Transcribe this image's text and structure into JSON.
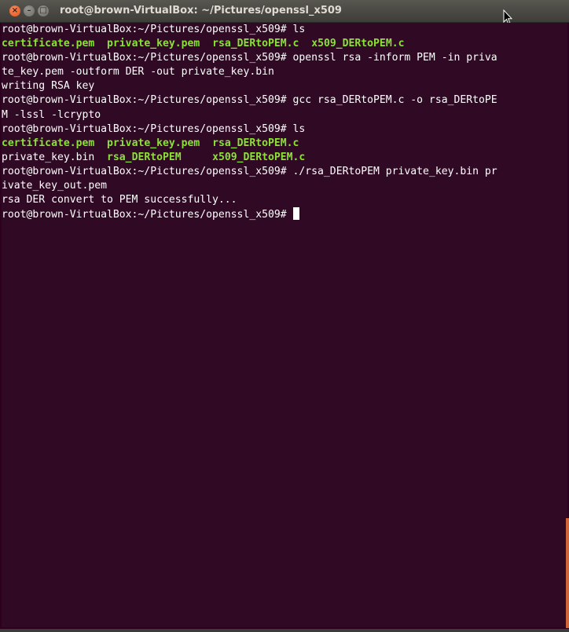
{
  "window": {
    "title": "root@brown-VirtualBox: ~/Pictures/openssl_x509",
    "close_glyph": "×",
    "minimize_glyph": "–",
    "maximize_glyph": "□"
  },
  "terminal": {
    "lines": [
      "root@brown-VirtualBox:~/Pictures/openssl_x509# ls",
      [
        "certificate.pem",
        "  ",
        "private_key.pem",
        "  ",
        "rsa_DERtoPEM.c",
        "  ",
        "x509_DERtoPEM.c"
      ],
      "root@brown-VirtualBox:~/Pictures/openssl_x509# openssl rsa -inform PEM -in priva",
      "te_key.pem -outform DER -out private_key.bin",
      "writing RSA key",
      "root@brown-VirtualBox:~/Pictures/openssl_x509# gcc rsa_DERtoPEM.c -o rsa_DERtoPE",
      "M -lssl -lcrypto",
      "root@brown-VirtualBox:~/Pictures/openssl_x509# ls",
      [
        "certificate.pem",
        "  ",
        "private_key.pem",
        "  ",
        "rsa_DERtoPEM.c"
      ],
      [
        "private_key.bin",
        "  ",
        "rsa_DERtoPEM",
        "     ",
        "x509_DERtoPEM.c"
      ],
      "root@brown-VirtualBox:~/Pictures/openssl_x509# ./rsa_DERtoPEM private_key.bin pr",
      "ivate_key_out.pem",
      "rsa DER convert to PEM successfully...",
      "root@brown-VirtualBox:~/Pictures/openssl_x509# "
    ]
  },
  "colors": {
    "background": "#300a24",
    "text": "#ffffff",
    "highlight": "#8ae234"
  }
}
